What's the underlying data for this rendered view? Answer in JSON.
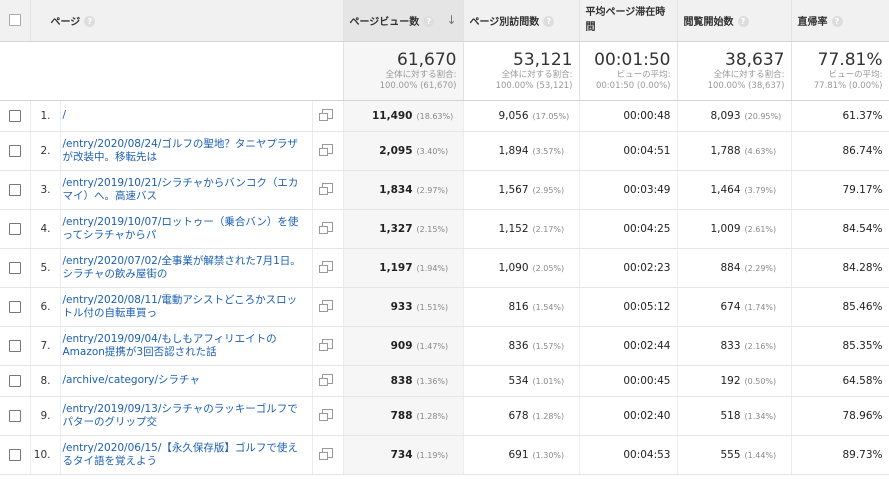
{
  "headers": {
    "page": "ページ",
    "pageviews": "ページビュー数",
    "unique": "ページ別訪問数",
    "avg_time": "平均ページ滞在時間",
    "entrances": "閲覧開始数",
    "bounce": "直帰率"
  },
  "totals": {
    "pageviews": {
      "value": "61,670",
      "l1": "全体に対する割合:",
      "l2": "100.00% (61,670)"
    },
    "unique": {
      "value": "53,121",
      "l1": "全体に対する割合:",
      "l2": "100.00% (53,121)"
    },
    "avg_time": {
      "value": "00:01:50",
      "l1": "ビューの平均:",
      "l2": "00:01:50 (0.00%)"
    },
    "entrances": {
      "value": "38,637",
      "l1": "全体に対する割合:",
      "l2": "100.00% (38,637)"
    },
    "bounce": {
      "value": "77.81%",
      "l1": "ビューの平均:",
      "l2": "77.81% (0.00%)"
    }
  },
  "rows": [
    {
      "n": "1.",
      "page": "/",
      "pv": "11,490",
      "pvp": "(18.63%)",
      "uv": "9,056",
      "uvp": "(17.05%)",
      "t": "00:00:48",
      "en": "8,093",
      "enp": "(20.95%)",
      "br": "61.37%"
    },
    {
      "n": "2.",
      "page": "/entry/2020/08/24/ゴルフの聖地？タニヤプラザが改装中。移転先は",
      "pv": "2,095",
      "pvp": "(3.40%)",
      "uv": "1,894",
      "uvp": "(3.57%)",
      "t": "00:04:51",
      "en": "1,788",
      "enp": "(4.63%)",
      "br": "86.74%"
    },
    {
      "n": "3.",
      "page": "/entry/2019/10/21/シラチャからバンコク（エカマイ）へ。高速バス",
      "pv": "1,834",
      "pvp": "(2.97%)",
      "uv": "1,567",
      "uvp": "(2.95%)",
      "t": "00:03:49",
      "en": "1,464",
      "enp": "(3.79%)",
      "br": "79.17%"
    },
    {
      "n": "4.",
      "page": "/entry/2019/10/07/ロットゥー（乗合バン）を使ってシラチャからパ",
      "pv": "1,327",
      "pvp": "(2.15%)",
      "uv": "1,152",
      "uvp": "(2.17%)",
      "t": "00:04:25",
      "en": "1,009",
      "enp": "(2.61%)",
      "br": "84.54%"
    },
    {
      "n": "5.",
      "page": "/entry/2020/07/02/全事業が解禁された7月1日。シラチャの飲み屋街の",
      "pv": "1,197",
      "pvp": "(1.94%)",
      "uv": "1,090",
      "uvp": "(2.05%)",
      "t": "00:02:23",
      "en": "884",
      "enp": "(2.29%)",
      "br": "84.28%"
    },
    {
      "n": "6.",
      "page": "/entry/2020/08/11/電動アシストどころかスロットル付の自転車買っ",
      "pv": "933",
      "pvp": "(1.51%)",
      "uv": "816",
      "uvp": "(1.54%)",
      "t": "00:05:12",
      "en": "674",
      "enp": "(1.74%)",
      "br": "85.46%"
    },
    {
      "n": "7.",
      "page": "/entry/2019/09/04/もしもアフィリエイトのAmazon提携が3回否認された話",
      "pv": "909",
      "pvp": "(1.47%)",
      "uv": "836",
      "uvp": "(1.57%)",
      "t": "00:02:44",
      "en": "833",
      "enp": "(2.16%)",
      "br": "85.35%"
    },
    {
      "n": "8.",
      "page": "/archive/category/シラチャ",
      "pv": "838",
      "pvp": "(1.36%)",
      "uv": "534",
      "uvp": "(1.01%)",
      "t": "00:00:45",
      "en": "192",
      "enp": "(0.50%)",
      "br": "64.58%"
    },
    {
      "n": "9.",
      "page": "/entry/2019/09/13/シラチャのラッキーゴルフでパターのグリップ交",
      "pv": "788",
      "pvp": "(1.28%)",
      "uv": "678",
      "uvp": "(1.28%)",
      "t": "00:02:40",
      "en": "518",
      "enp": "(1.34%)",
      "br": "78.96%"
    },
    {
      "n": "10.",
      "page": "/entry/2020/06/15/【永久保存版】ゴルフで使えるタイ語を覚えよう",
      "pv": "734",
      "pvp": "(1.19%)",
      "uv": "691",
      "uvp": "(1.30%)",
      "t": "00:04:53",
      "en": "555",
      "enp": "(1.44%)",
      "br": "89.73%"
    }
  ],
  "icons": {
    "help": "question-circle-icon",
    "sort": "arrow-down-icon",
    "popout": "open-in-new-window-icon"
  }
}
